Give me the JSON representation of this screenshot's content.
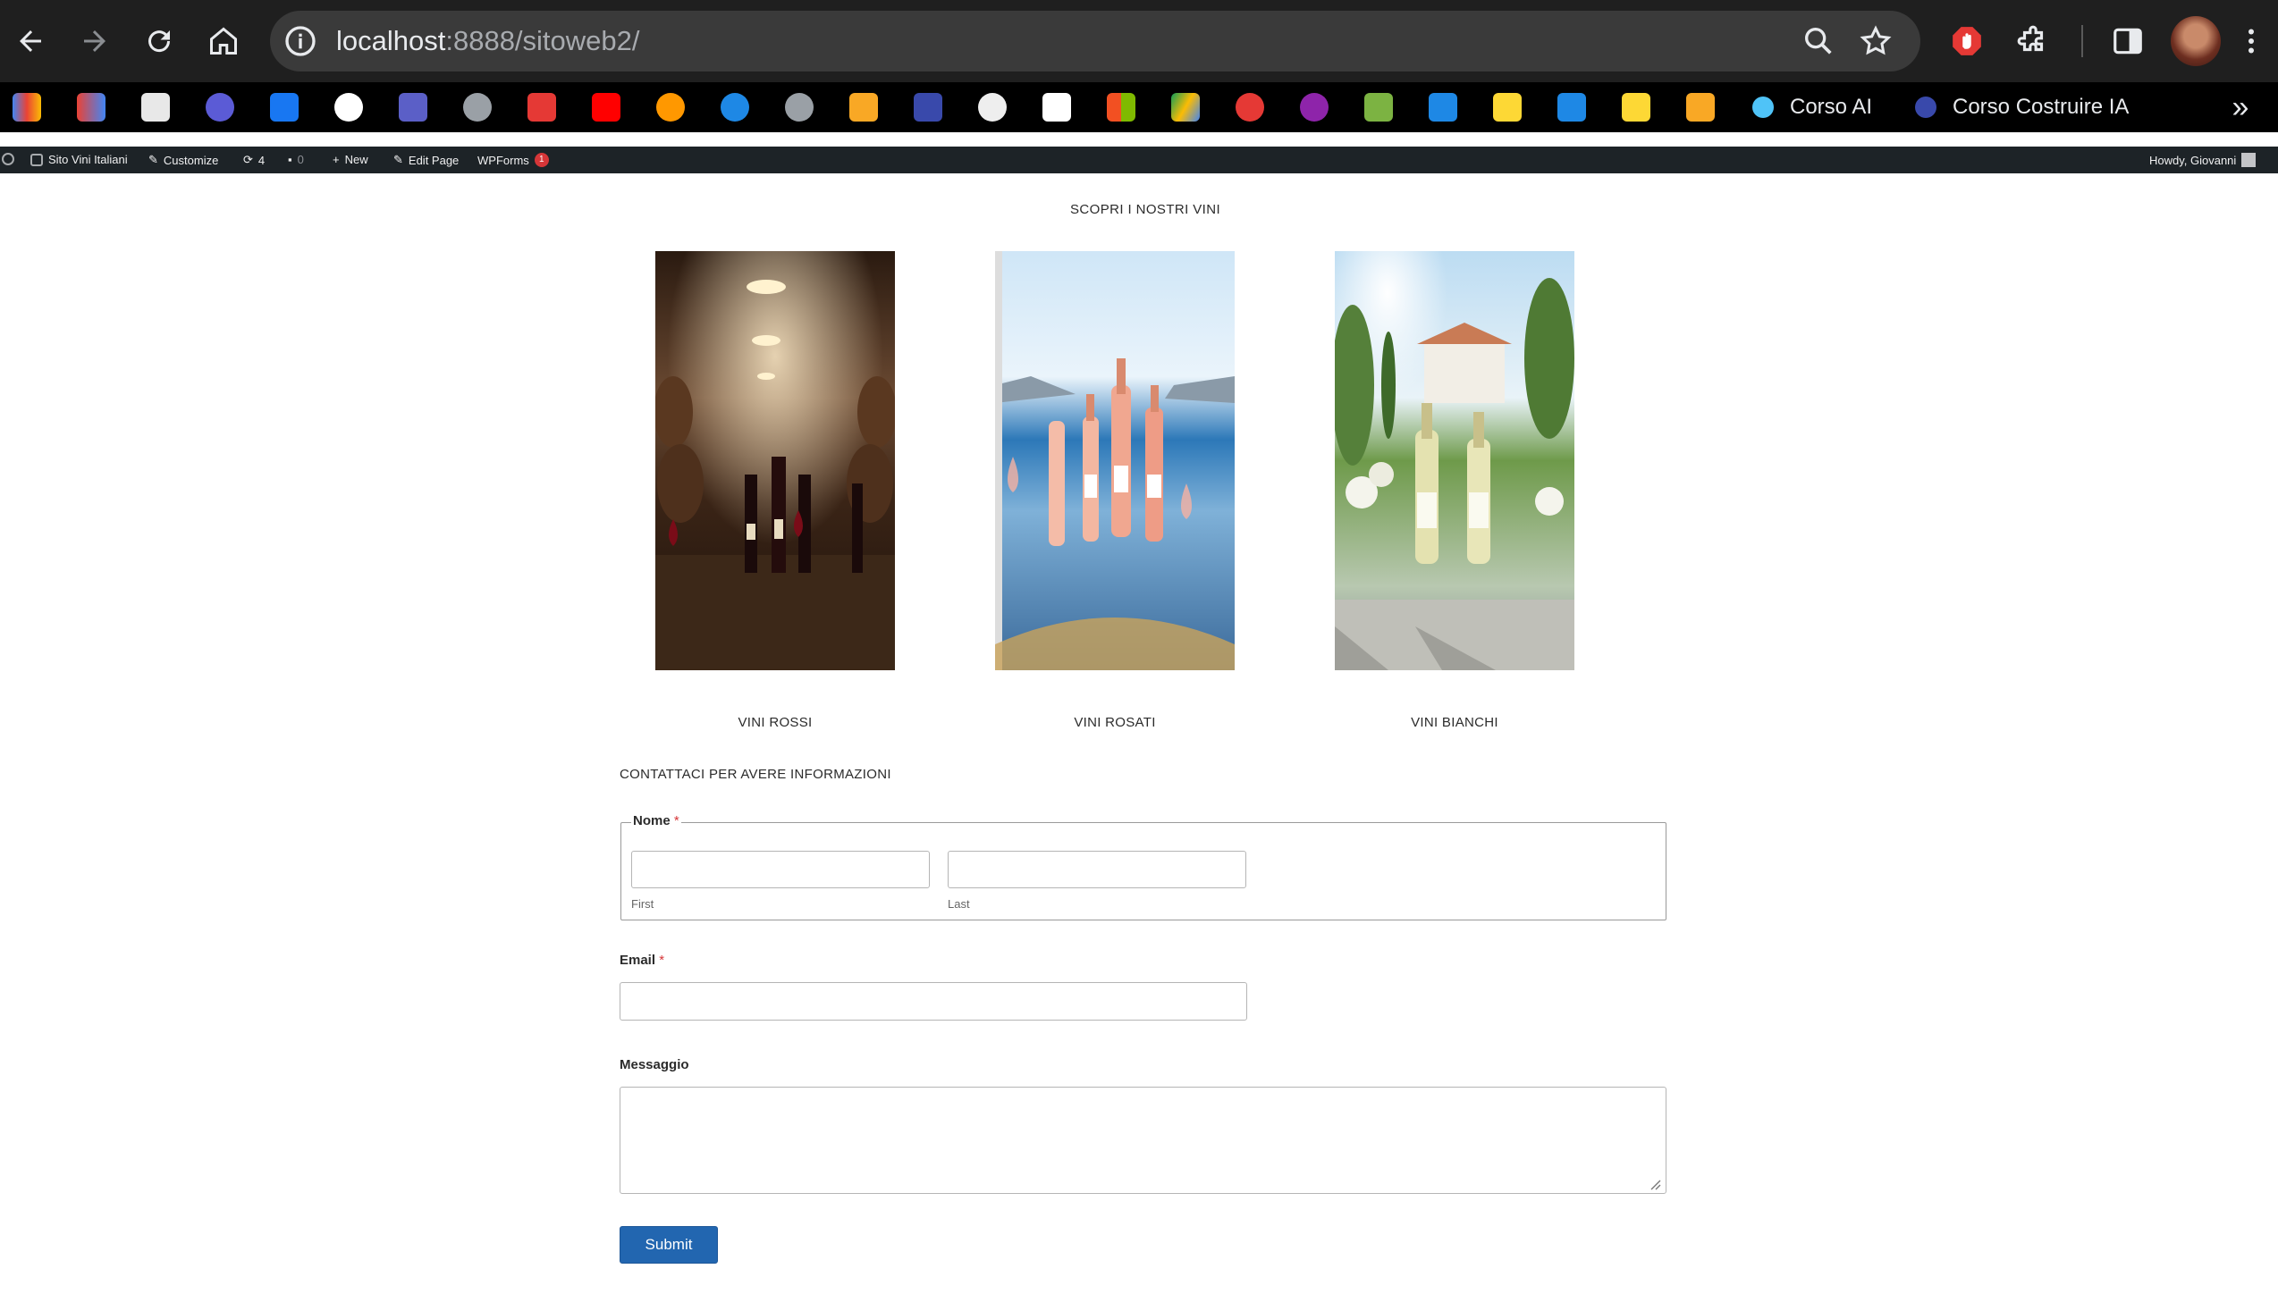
{
  "browser": {
    "url_host": "localhost",
    "url_rest": ":8888/sitoweb2/",
    "bookmarks": [
      {
        "label": "Corso AI",
        "color": "#4fc3f7"
      },
      {
        "label": "Corso Costruire IA",
        "color": "#3949ab"
      }
    ]
  },
  "admin_bar": {
    "site_name": "Sito Vini Italiani",
    "customize": "Customize",
    "updates_count": "4",
    "comments_count": "0",
    "new_label": "New",
    "edit_page": "Edit Page",
    "wpforms": "WPForms",
    "wpforms_badge": "1",
    "howdy": "Howdy, Giovanni"
  },
  "page": {
    "section_title": "SCOPRI I NOSTRI VINI",
    "wines": [
      {
        "label": "VINI ROSSI",
        "image": "red-wine-cellar-image"
      },
      {
        "label": "VINI ROSATI",
        "image": "rose-wine-seaside-image"
      },
      {
        "label": "VINI BIANCHI",
        "image": "white-wine-villa-image"
      }
    ],
    "contact_title": "CONTATTACI PER AVERE INFORMAZIONI"
  },
  "form": {
    "name_label": "Nome",
    "required_mark": "*",
    "first_sublabel": "First",
    "last_sublabel": "Last",
    "email_label": "Email",
    "message_label": "Messaggio",
    "submit_label": "Submit"
  },
  "colors": {
    "submit_button": "#2266b0",
    "required": "#d63638"
  }
}
